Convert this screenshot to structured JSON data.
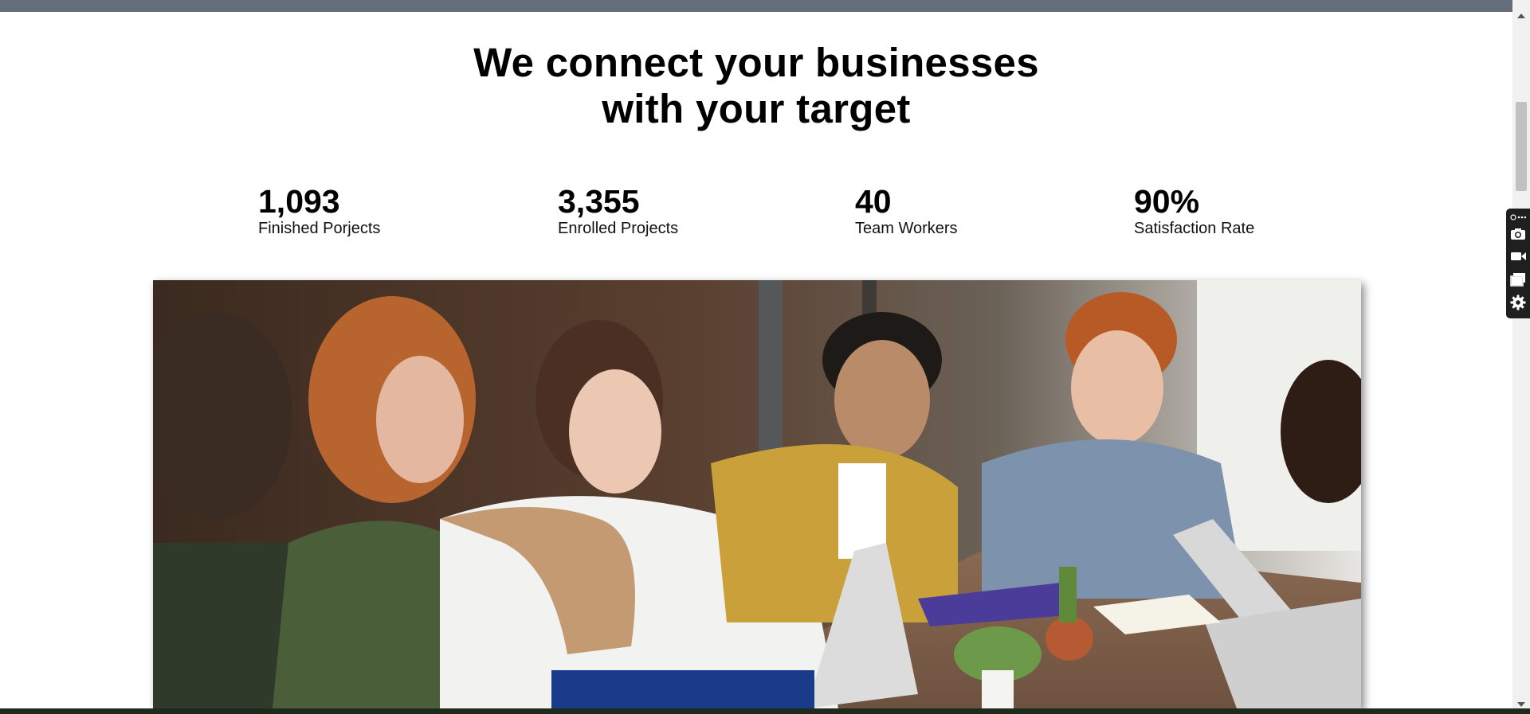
{
  "hero": {
    "title_line1": "We connect your businesses",
    "title_line2": "with your target"
  },
  "stats": [
    {
      "value": "1,093",
      "label": "Finished Porjects"
    },
    {
      "value": "3,355",
      "label": "Enrolled Projects"
    },
    {
      "value": "40",
      "label": "Team Workers"
    },
    {
      "value": "90%",
      "label": "Satisfaction Rate"
    }
  ],
  "colors": {
    "top_bar": "#646e7a",
    "text": "#000000",
    "toolbar_bg": "#1f1f1f"
  },
  "extension_toolbar": {
    "icons": [
      "menu-dots-icon",
      "camera-icon",
      "video-camera-icon",
      "windows-icon",
      "gear-icon"
    ]
  }
}
